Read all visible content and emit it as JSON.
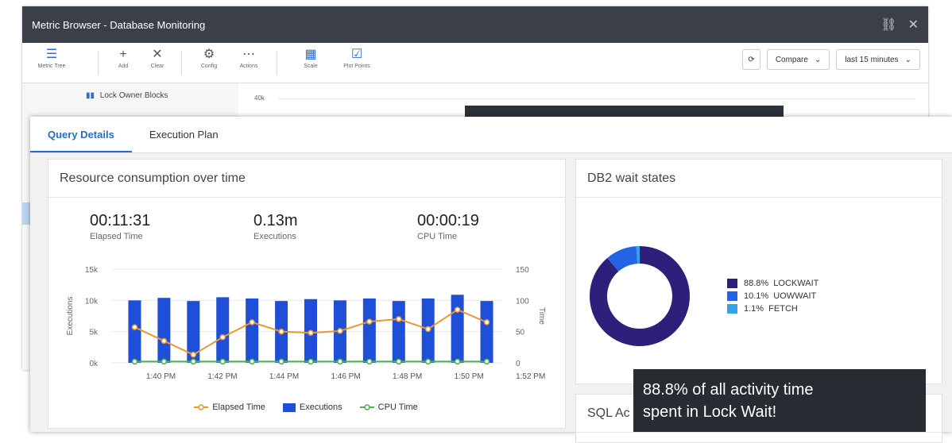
{
  "window": {
    "title": "Metric Browser - Database Monitoring"
  },
  "toolbar": {
    "metric_tree": "Metric Tree",
    "add": "Add",
    "clear": "Clear",
    "config": "Config",
    "actions": "Actions",
    "scale": "Scale",
    "plot_points": "Plot Points",
    "compare": "Compare",
    "time_range": "last 15 minutes"
  },
  "sidebar": {
    "items": [
      {
        "label": "Lock Owner Blocks"
      }
    ]
  },
  "bg_chart": {
    "y_label": "40k"
  },
  "tabs": [
    {
      "label": "Query Details",
      "active": true
    },
    {
      "label": "Execution Plan",
      "active": false
    }
  ],
  "resource_card": {
    "title": "Resource consumption over time",
    "stats": [
      {
        "value": "00:11:31",
        "label": "Elapsed Time"
      },
      {
        "value": "0.13m",
        "label": "Executions"
      },
      {
        "value": "00:00:19",
        "label": "CPU Time"
      }
    ],
    "legend": [
      "Elapsed Time",
      "Executions",
      "CPU Time"
    ]
  },
  "wait_card": {
    "title": "DB2 wait states"
  },
  "sql_card": {
    "title_partial": "SQL Ac"
  },
  "overlay": {
    "line1": "88.8% of all activity time",
    "line2": "spent in Lock Wait!"
  },
  "colors": {
    "executions": "#1f4fd8",
    "elapsed": "#f0962b",
    "cpu": "#4cb04c",
    "lockwait": "#2d1f7a",
    "uowwait": "#2463e6",
    "fetch": "#36a3e8"
  },
  "chart_data": [
    {
      "type": "bar",
      "title": "Resource consumption over time",
      "xlabel": "",
      "ylabel": "Executions",
      "y2label": "Time",
      "ylim": [
        0,
        15000
      ],
      "y2lim": [
        0,
        150
      ],
      "yticks": [
        "0k",
        "5k",
        "10k",
        "15k"
      ],
      "y2ticks": [
        "0",
        "50",
        "100",
        "150"
      ],
      "x_ticks": [
        "1:40 PM",
        "1:42 PM",
        "1:44 PM",
        "1:46 PM",
        "1:48 PM",
        "1:50 PM",
        "1:52 PM"
      ],
      "grid": true,
      "legend": "bottom",
      "series": [
        {
          "name": "Executions",
          "type": "bar",
          "axis": "left",
          "values": [
            10000,
            10400,
            9900,
            10500,
            10300,
            9900,
            10200,
            10000,
            10300,
            9900,
            10300,
            10900,
            9900
          ]
        },
        {
          "name": "Elapsed Time",
          "type": "line",
          "axis": "right",
          "values": [
            57,
            35,
            13,
            41,
            65,
            50,
            48,
            51,
            66,
            70,
            54,
            85,
            65
          ]
        },
        {
          "name": "CPU Time",
          "type": "line",
          "axis": "right",
          "values": [
            2,
            2,
            2,
            2,
            2,
            2,
            2,
            2,
            2,
            2,
            2,
            2,
            2
          ]
        }
      ]
    },
    {
      "type": "pie",
      "title": "DB2 wait states",
      "donut": true,
      "legend": "right",
      "slices": [
        {
          "label": "LOCKWAIT",
          "value": 88.8,
          "display": "88.8%"
        },
        {
          "label": "UOWWAIT",
          "value": 10.1,
          "display": "10.1%"
        },
        {
          "label": "FETCH",
          "value": 1.1,
          "display": "1.1%"
        }
      ]
    }
  ]
}
